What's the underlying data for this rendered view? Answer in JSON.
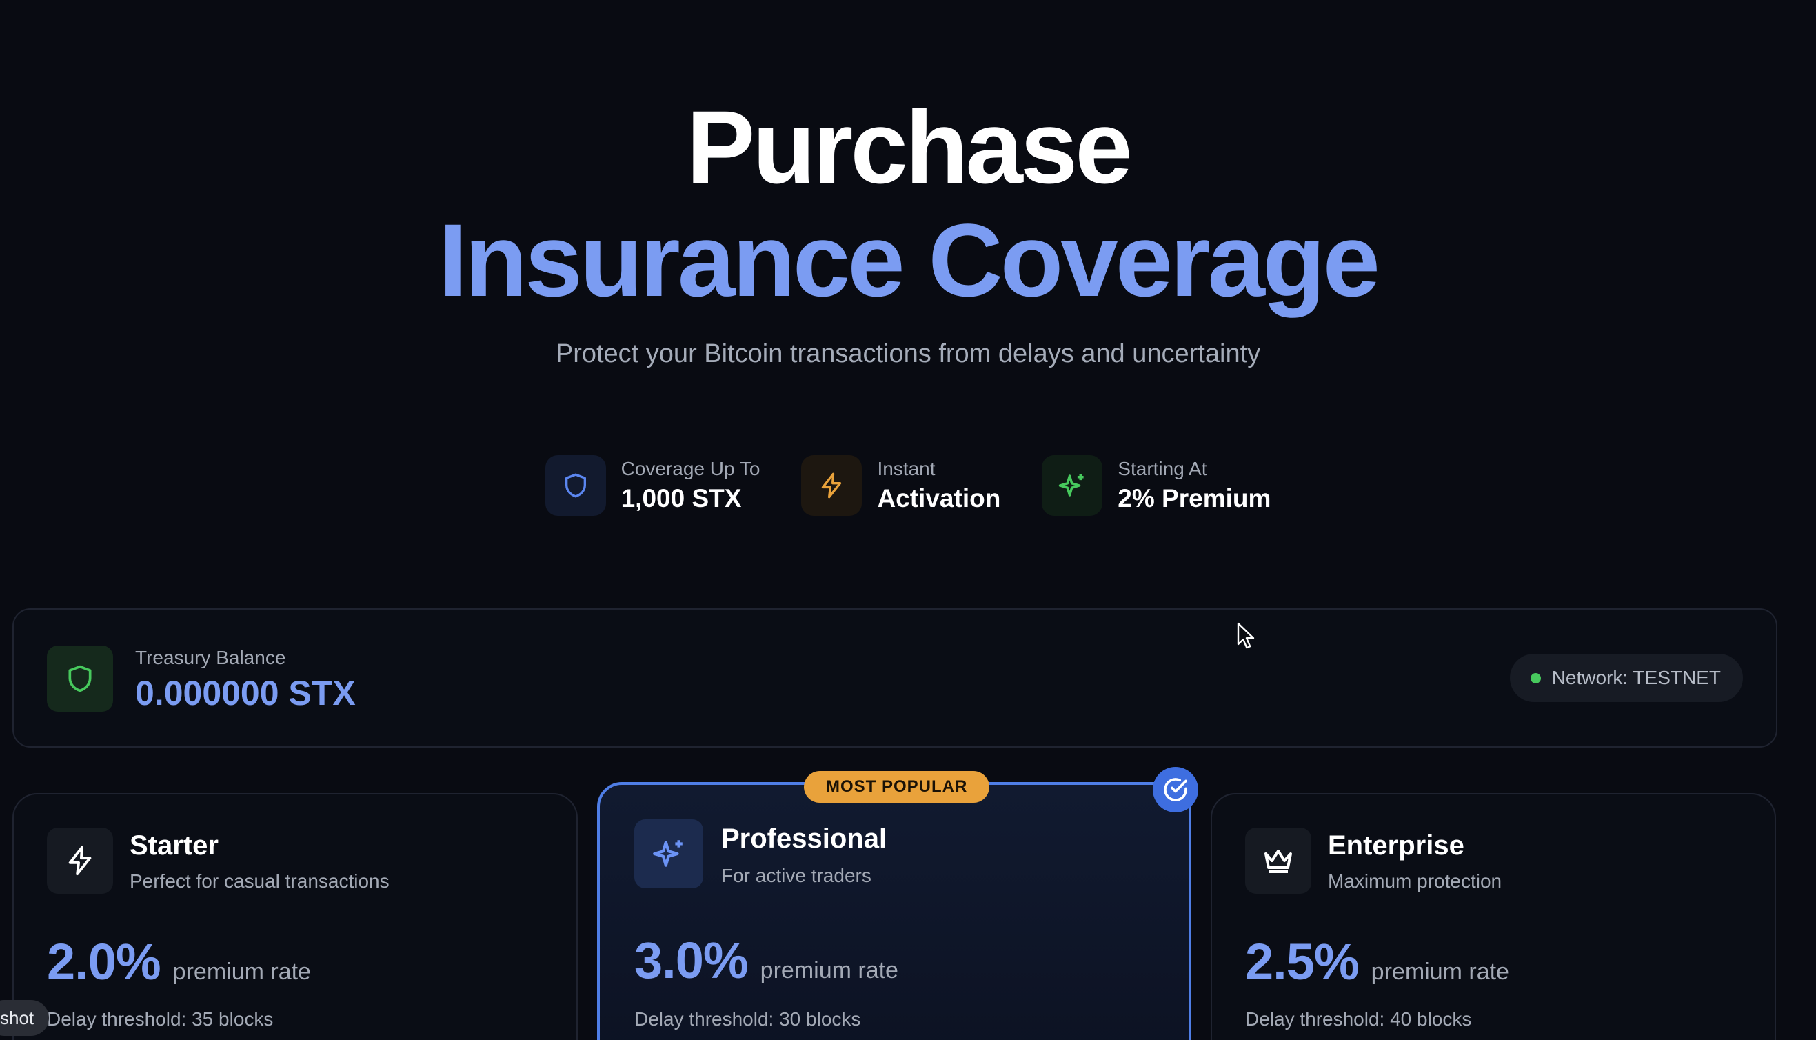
{
  "hero": {
    "title_line1": "Purchase",
    "title_line2": "Insurance Coverage",
    "subtitle": "Protect your Bitcoin transactions from delays and uncertainty"
  },
  "features": [
    {
      "icon": "shield-icon",
      "label": "Coverage Up To",
      "value": "1,000 STX",
      "color": "#5b86f0"
    },
    {
      "icon": "lightning-icon",
      "label": "Instant",
      "value": "Activation",
      "color": "#e9a23b"
    },
    {
      "icon": "sparkle-icon",
      "label": "Starting At",
      "value": "2% Premium",
      "color": "#47c95d"
    }
  ],
  "treasury": {
    "icon": "shield-icon",
    "label": "Treasury Balance",
    "value": "0.000000 STX",
    "network": "Network: TESTNET",
    "network_status_color": "#47c95d"
  },
  "plans": [
    {
      "id": "starter",
      "icon": "lightning-icon",
      "name": "Starter",
      "description": "Perfect for casual transactions",
      "rate": "2.0%",
      "rate_label": "premium rate",
      "delay": "Delay threshold: 35 blocks",
      "selected": false
    },
    {
      "id": "professional",
      "icon": "sparkle-icon",
      "name": "Professional",
      "description": "For active traders",
      "rate": "3.0%",
      "rate_label": "premium rate",
      "delay": "Delay threshold: 30 blocks",
      "badge": "MOST POPULAR",
      "selected": true
    },
    {
      "id": "enterprise",
      "icon": "crown-icon",
      "name": "Enterprise",
      "description": "Maximum protection",
      "rate": "2.5%",
      "rate_label": "premium rate",
      "delay": "Delay threshold: 40 blocks",
      "selected": false
    }
  ],
  "overlay": {
    "tag": "shot"
  },
  "colors": {
    "accent": "#7b9cf2",
    "background": "#090b12",
    "badge": "#e9a23b",
    "selected_border": "#4f7ee6"
  }
}
